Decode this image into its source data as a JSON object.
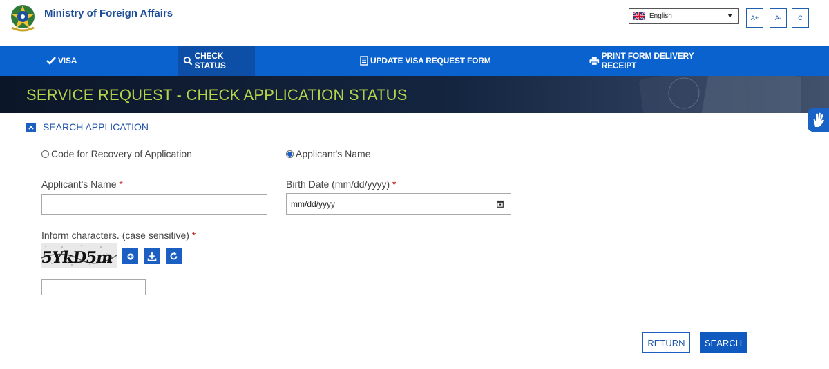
{
  "header": {
    "title": "Ministry of Foreign Affairs",
    "language": "English",
    "font_buttons": [
      "A+",
      "A-",
      "C"
    ]
  },
  "nav": {
    "items": [
      {
        "label": "VISA",
        "icon": "check-icon"
      },
      {
        "label": "CHECK STATUS",
        "icon": "search-icon",
        "active": true
      },
      {
        "label": "UPDATE VISA REQUEST FORM",
        "icon": "document-icon"
      },
      {
        "label": "PRINT FORM DELIVERY RECEIPT",
        "icon": "printer-icon"
      }
    ]
  },
  "banner": {
    "title": "SERVICE REQUEST - CHECK APPLICATION STATUS"
  },
  "section": {
    "title": "SEARCH APPLICATION",
    "options": [
      {
        "label": "Code for Recovery of Application",
        "selected": false
      },
      {
        "label": "Applicant's Name",
        "selected": true
      }
    ],
    "name_label": "Applicant's Name",
    "name_value": "",
    "birth_label": "Birth Date (mm/dd/yyyy)",
    "birth_placeholder": "mm/dd/yyyy",
    "captcha_label": "Inform characters. (case sensitive)",
    "captcha_text": "5YkD5m",
    "captcha_value": "",
    "required_mark": "*"
  },
  "actions": {
    "return_label": "RETURN",
    "search_label": "SEARCH"
  },
  "colors": {
    "primary": "#0a62cf",
    "nav_active": "#0d4ea6",
    "banner_title": "#b5d44a",
    "required": "#c02020"
  }
}
